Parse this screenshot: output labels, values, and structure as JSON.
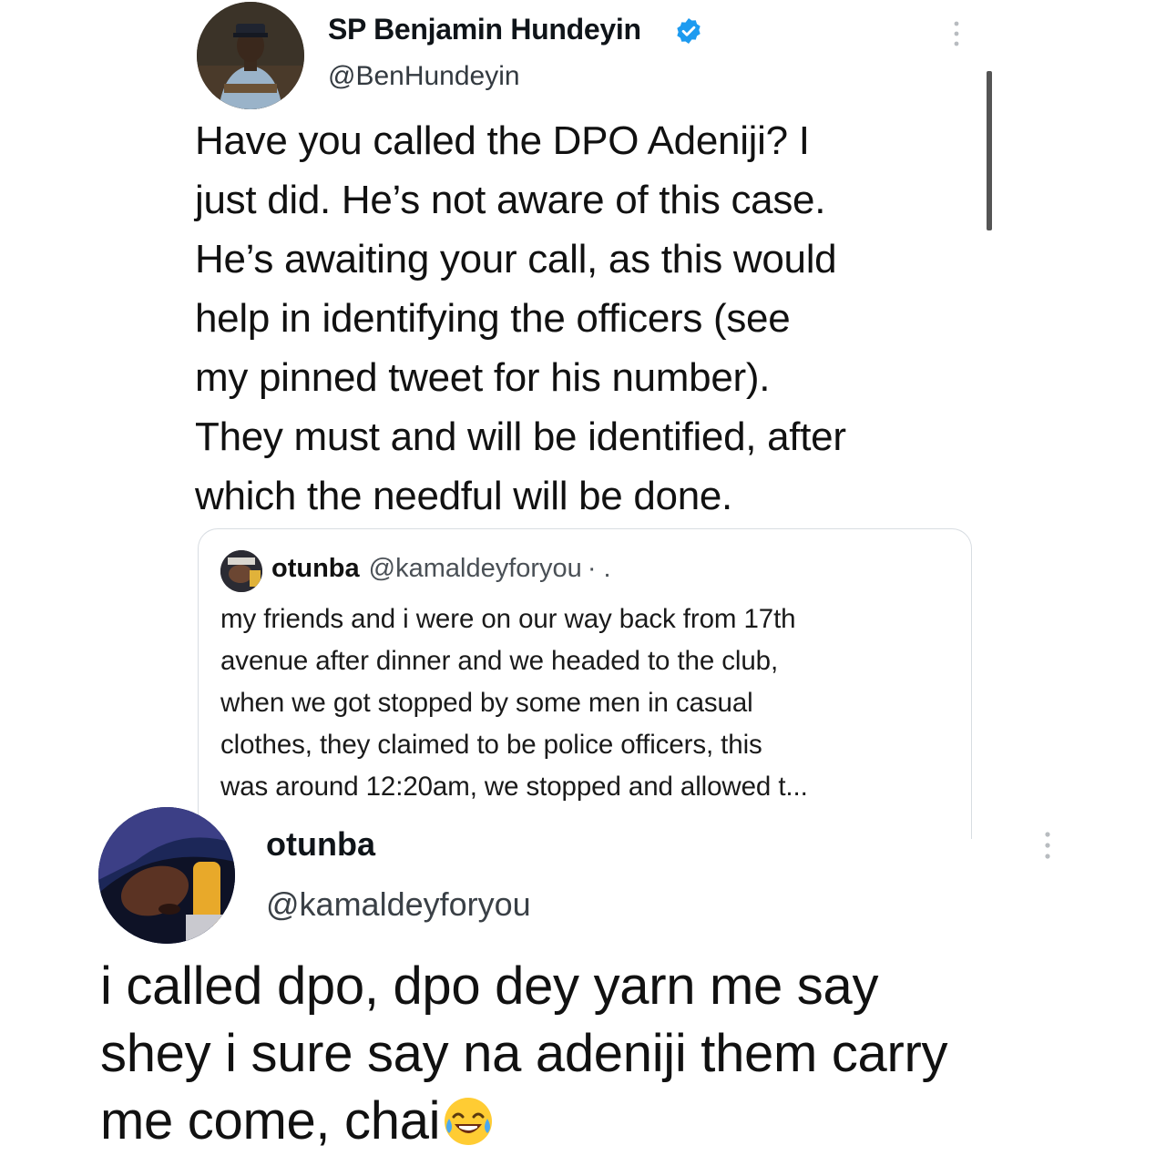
{
  "tweet_main": {
    "display_name": "SP Benjamin Hundeyin",
    "handle": "@BenHundeyin",
    "text": "Have you called the DPO Adeniji? I\njust did. He’s not aware of this case.\nHe’s awaiting your call, as this would\nhelp in identifying the officers (see\nmy pinned tweet for his number).\nThey must and will be identified, after\nwhich the needful will be done.",
    "verified_color": "#1d9bf0",
    "icons": [
      "verified-badge-icon",
      "more-vertical-icon"
    ]
  },
  "quoted_tweet": {
    "display_name": "otunba",
    "handle": "@kamaldeyforyou",
    "separator": "· .",
    "text": "my friends and i were on our way back from 17th\navenue after dinner and we headed to the club,\nwhen we got stopped by some men in casual\nclothes, they claimed to be police officers, this\nwas around 12:20am, we stopped and allowed t..."
  },
  "tweet_reply": {
    "display_name": "otunba",
    "handle": "@kamaldeyforyou",
    "text": "i called dpo, dpo dey yarn me say\nshey i sure say na adeniji them carry\nme come, chai",
    "emoji": "face-with-tears-of-joy",
    "icons": [
      "more-vertical-icon"
    ]
  }
}
